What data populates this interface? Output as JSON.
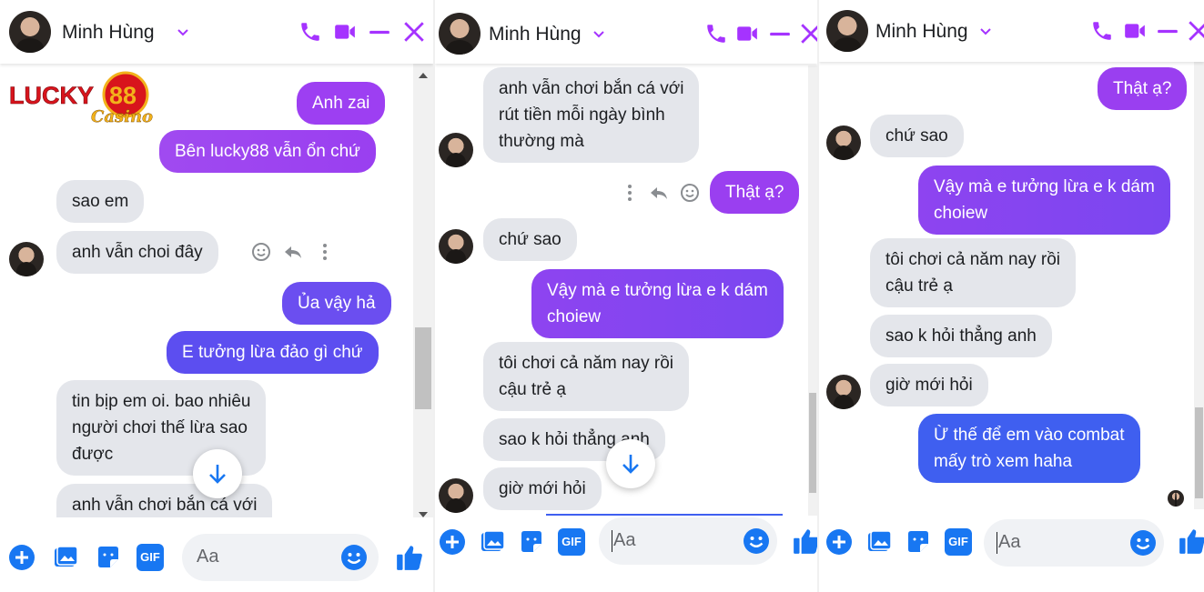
{
  "colors": {
    "messenger_purple": "#9a3ff0",
    "gradient_blue": "#3f5ff0",
    "icon_purple": "#a533ff",
    "icon_blue": "#1877f2",
    "incoming_bg": "#e4e6eb"
  },
  "panels": [
    {
      "contact_name": "Minh Hùng",
      "logo": {
        "text_main": "LUCKY",
        "text_num": "88",
        "text_script": "Casino"
      },
      "messages": [
        {
          "from": "me",
          "text": "Anh zai"
        },
        {
          "from": "me",
          "text": "Bên lucky88 vẫn ổn chứ"
        },
        {
          "from": "them",
          "text": "sao em"
        },
        {
          "from": "them",
          "text": "anh vẫn choi đây"
        },
        {
          "from": "me",
          "text": "Ủa vậy hả"
        },
        {
          "from": "me",
          "text": "E tưởng lừa đảo gì chứ"
        },
        {
          "from": "them",
          "lines": [
            "tin bịp em oi. bao nhiêu",
            "người chơi thế lừa sao",
            "được"
          ]
        },
        {
          "from": "them",
          "lines": [
            "anh vẫn chơi bắn cá với"
          ]
        }
      ],
      "input_placeholder": "Aa"
    },
    {
      "contact_name": "Minh Hùng",
      "messages": [
        {
          "from": "them",
          "lines": [
            "anh vẫn chơi bắn cá với",
            "rút tiền mỗi ngày bình",
            "thường mà"
          ]
        },
        {
          "from": "me",
          "text": "Thật ạ?"
        },
        {
          "from": "them",
          "text": "chứ sao"
        },
        {
          "from": "me",
          "lines": [
            "Vậy mà e tưởng lừa e k dám",
            "choiew"
          ]
        },
        {
          "from": "them",
          "lines": [
            "tôi chơi cả năm nay rồi",
            "cậu trẻ ạ"
          ]
        },
        {
          "from": "them",
          "text": "sao k hỏi thẳng anh"
        },
        {
          "from": "them",
          "text": "giờ mới hỏi"
        }
      ],
      "input_placeholder": "Aa"
    },
    {
      "contact_name": "Minh Hùng",
      "messages": [
        {
          "from": "me",
          "text": "Thật ạ?"
        },
        {
          "from": "them",
          "text": "chứ sao"
        },
        {
          "from": "me",
          "lines": [
            "Vậy mà e tưởng lừa e k dám",
            "choiew"
          ]
        },
        {
          "from": "them",
          "lines": [
            "tôi chơi cả năm nay rồi",
            "cậu trẻ ạ"
          ]
        },
        {
          "from": "them",
          "text": "sao k hỏi thẳng anh"
        },
        {
          "from": "them",
          "text": "giờ mới hỏi"
        },
        {
          "from": "me",
          "lines": [
            "Ừ thế để em vào combat",
            "mấy trò xem haha"
          ]
        }
      ],
      "input_placeholder": "Aa"
    }
  ],
  "icons": {
    "header": [
      "phone-icon",
      "video-icon",
      "minimize-icon",
      "close-icon"
    ],
    "footer": [
      "plus-icon",
      "image-icon",
      "sticker-icon",
      "gif-icon",
      "emoji-icon",
      "like-icon"
    ],
    "message_actions": [
      "react-icon",
      "reply-icon",
      "more-icon"
    ]
  },
  "gif_label": "GIF"
}
